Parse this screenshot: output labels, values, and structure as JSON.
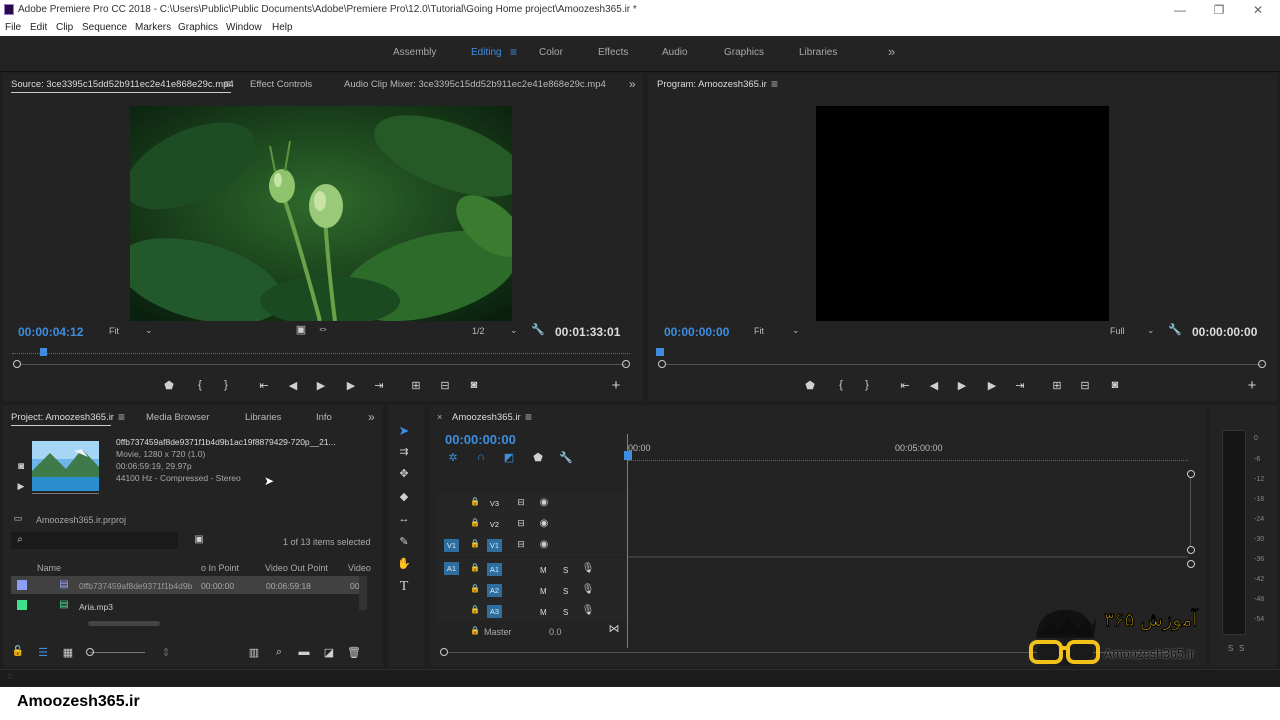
{
  "app": {
    "title": "Adobe Premiere Pro CC 2018 - C:\\Users\\Public\\Public Documents\\Adobe\\Premiere Pro\\12.0\\Tutorial\\Going Home project\\Amoozesh365.ir *"
  },
  "window_controls": {
    "minimize": "—",
    "maximize": "❐",
    "close": "✕"
  },
  "menu": [
    "File",
    "Edit",
    "Clip",
    "Sequence",
    "Markers",
    "Graphics",
    "Window",
    "Help"
  ],
  "workspaces": {
    "items": [
      "Assembly",
      "Editing",
      "Color",
      "Effects",
      "Audio",
      "Graphics",
      "Libraries"
    ],
    "active": "Editing",
    "more": "»",
    "menu": "≡"
  },
  "source": {
    "tabs": [
      "Source: 3ce3395c15dd52b911ec2e41e868e29c.mp4",
      "Effect Controls",
      "Audio Clip Mixer: 3ce3395c15dd52b911ec2e41e868e29c.mp4"
    ],
    "menu": "≡",
    "more": "»",
    "timecode": "00:00:04:12",
    "fit": "Fit",
    "resolution": "1/2",
    "duration": "00:01:33:01",
    "playhead_fraction": 0.045
  },
  "program": {
    "tab": "Program: Amoozesh365.ir",
    "menu": "≡",
    "timecode": "00:00:00:00",
    "fit": "Fit",
    "resolution": "Full",
    "duration": "00:00:00:00"
  },
  "project": {
    "tabs": [
      "Project: Amoozesh365.ir",
      "Media Browser",
      "Libraries",
      "Info"
    ],
    "menu": "≡",
    "more": "»",
    "clip_name": "0ffb737459af8de9371f1b4d9b1ac19f8879429-720p__21...",
    "clip_info": [
      "Movie, 1280 x 720 (1.0)",
      "00:06:59:19, 29.97p",
      "44100 Hz - Compressed - Stereo"
    ],
    "file": "Amoozesh365.ir.prproj",
    "items_selected": "1 of 13 items selected",
    "columns": [
      "Name",
      "o In Point",
      "Video Out Point",
      "Video"
    ],
    "rows": [
      {
        "name": "0ffb737459af8de9371f1b4d9b",
        "in": "00:00:00",
        "out": "00:06:59:18",
        "extra": "00",
        "color": "#8c9ef5"
      },
      {
        "name": "Aria.mp3",
        "in": "",
        "out": "",
        "extra": "",
        "color": "#3fe08b"
      }
    ]
  },
  "timeline": {
    "tab": "Amoozesh365.ir",
    "menu": "≡",
    "timecode": "00:00:00:00",
    "ruler": [
      "00:00",
      "00:05:00:00"
    ],
    "video_tracks": [
      "V3",
      "V2",
      "V1"
    ],
    "audio_tracks": [
      "A1",
      "A2",
      "A3"
    ],
    "source_patch": [
      "V1",
      "A1"
    ],
    "mute": "M",
    "solo": "S",
    "master_label": "Master",
    "master_value": "0.0"
  },
  "meters": {
    "scale": [
      "0",
      "-6",
      "-12",
      "-18",
      "-24",
      "-30",
      "-36",
      "-42",
      "-48",
      "-54"
    ],
    "solo": [
      "S",
      "S"
    ]
  },
  "watermark": {
    "logo_text": "آموزش ۳۶۵",
    "url": "Amoozesh365.ir"
  },
  "footer": {
    "brand": "Amoozesh365.ir"
  },
  "colors": {
    "accent": "#3e8ee0",
    "panel": "#232323",
    "bg": "#1e1e1e"
  }
}
